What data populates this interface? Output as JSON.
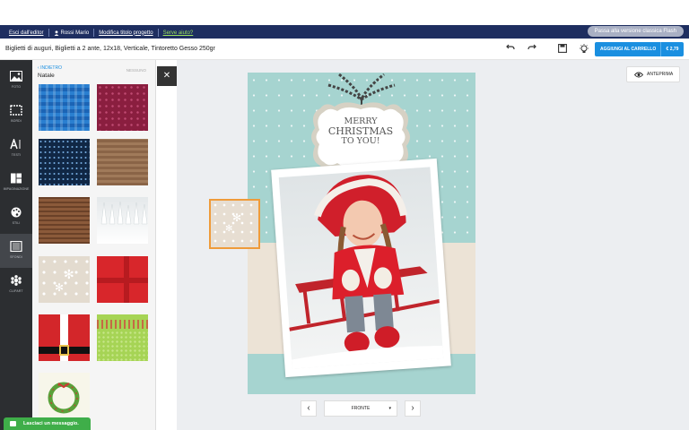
{
  "topbar": {
    "exit_editor": "Esci dall'editor",
    "user_name": "Rossi Mario",
    "edit_title": "Modifica titolo progetto",
    "help": "Serve aiuto?",
    "flash_version": "Passa alla versione classica Flash"
  },
  "titlebar": {
    "project_title": "Biglietti di auguri, Biglietti a 2 ante, 12x18, Verticale, Tintoretto Gesso 250gr",
    "cart_label": "AGGIUNGI AL CARRELLO",
    "cart_price": "€ 2,79"
  },
  "rail": {
    "items": [
      {
        "label": "FOTO",
        "icon": "photo-icon"
      },
      {
        "label": "BORDI",
        "icon": "frame-icon"
      },
      {
        "label": "TESTI",
        "icon": "text-icon"
      },
      {
        "label": "IMPAGINAZIONE",
        "icon": "layout-icon"
      },
      {
        "label": "STILI",
        "icon": "palette-icon"
      },
      {
        "label": "SFONDI",
        "icon": "background-icon"
      },
      {
        "label": "CLIPART",
        "icon": "clipart-icon"
      }
    ],
    "active": "SFONDI"
  },
  "panel": {
    "back_label": "INDIETRO",
    "none_label": "NESSUNO",
    "category": "Natale",
    "tiles": [
      {
        "name": "blue-plaid"
      },
      {
        "name": "burgundy-pattern"
      },
      {
        "name": "starry-night"
      },
      {
        "name": "knit-brown"
      },
      {
        "name": "wood-brown"
      },
      {
        "name": "snow-trees"
      },
      {
        "name": "beige-snowflakes"
      },
      {
        "name": "red-gift"
      },
      {
        "name": "santa-belt"
      },
      {
        "name": "green-pattern"
      },
      {
        "name": "wreath"
      }
    ]
  },
  "card": {
    "greeting_line1": "MERRY",
    "greeting_line2": "CHRISTMAS",
    "greeting_line3": "TO YOU!"
  },
  "preview_label": "ANTEPRIMA",
  "pager": {
    "selected": "FRONTE"
  },
  "message_label": "Lasciaci un messaggio."
}
